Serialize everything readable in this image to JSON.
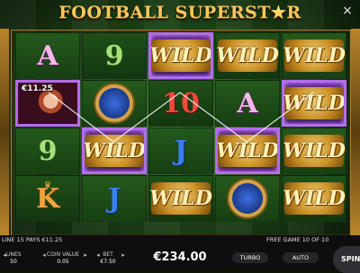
{
  "game": {
    "title": "FOOTBALL SUPERSTAR",
    "title_main": "FOOTBALL SUPERST",
    "title_star": "★",
    "title_tail": "R",
    "close_icon": "×"
  },
  "reels": [
    [
      {
        "symbol": "A",
        "type": "letter"
      },
      {
        "symbol": "woman",
        "type": "pic",
        "label": "€11.25",
        "highlight": true
      },
      {
        "symbol": "9",
        "type": "letter"
      },
      {
        "symbol": "K",
        "type": "letter"
      }
    ],
    [
      {
        "symbol": "9",
        "type": "letter"
      },
      {
        "symbol": "ring",
        "type": "pic"
      },
      {
        "symbol": "WILD",
        "type": "wild",
        "highlight": true
      },
      {
        "symbol": "J",
        "type": "letter"
      }
    ],
    [
      {
        "symbol": "WILD",
        "type": "wild",
        "highlight": true
      },
      {
        "symbol": "10",
        "type": "letter"
      },
      {
        "symbol": "J",
        "type": "letter"
      },
      {
        "symbol": "WILD",
        "type": "wild"
      }
    ],
    [
      {
        "symbol": "WILD",
        "type": "wild"
      },
      {
        "symbol": "A",
        "type": "letter"
      },
      {
        "symbol": "WILD",
        "type": "wild",
        "highlight": true
      },
      {
        "symbol": "ring",
        "type": "pic"
      }
    ],
    [
      {
        "symbol": "WILD",
        "type": "wild"
      },
      {
        "symbol": "WILD",
        "type": "wild",
        "highlight": true
      },
      {
        "symbol": "WILD",
        "type": "wild"
      },
      {
        "symbol": "WILD",
        "type": "wild"
      }
    ]
  ],
  "win_line": "LINE 15 PAYS €11.25",
  "free_game": "FREE GAME 10 OF 10",
  "controls": {
    "lines_label": "LINES",
    "lines_value": "50",
    "coin_label": "COIN VALUE",
    "coin_value": "0.05",
    "bet_label": "BET",
    "bet_value": "€7.50",
    "balance": "€234.00",
    "turbo_label": "TURBO",
    "auto_label": "AUTO",
    "spin_label": "SPIN"
  },
  "colors": {
    "highlight": "#b46bf0",
    "gold": "#f6c75a",
    "bar": "#0e0e10"
  }
}
